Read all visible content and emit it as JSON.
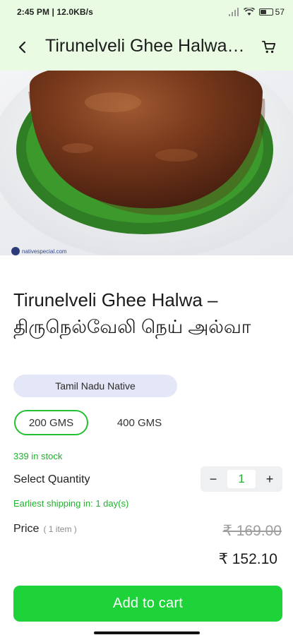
{
  "status_bar": {
    "time_speed": "2:45 PM | 12.0KB/s",
    "battery": "57",
    "battery_level": 0.57
  },
  "app_bar": {
    "title": "Tirunelveli Ghee Halwa – திருநெல்வேலி நெய் அல்வா",
    "back_icon": "arrow-back-icon",
    "cart_icon": "shopping-cart-icon"
  },
  "product": {
    "watermark": "nativespecial.com",
    "title": "Tirunelveli Ghee Halwa – திருநெல்வேலி நெய் அல்வா",
    "category": "Tamil Nadu Native",
    "variants": [
      "200 GMS",
      "400 GMS"
    ],
    "selected_variant": "200 GMS",
    "stock": "339 in stock",
    "quantity_label": "Select Quantity",
    "quantity": "1",
    "decrement": "−",
    "increment": "+",
    "shipping": "Earliest shipping in: 1 day(s)",
    "price_label": "Price",
    "price_items": "( 1 item )",
    "old_price": "₹ 169.00",
    "new_price": "₹ 152.10",
    "add_to_cart": "Add to cart"
  },
  "colors": {
    "accent": "#1ed23a",
    "app_bar_bg": "#e9fbe3",
    "chip_bg": "#e3e7f7",
    "stock_text": "#20b22f"
  }
}
